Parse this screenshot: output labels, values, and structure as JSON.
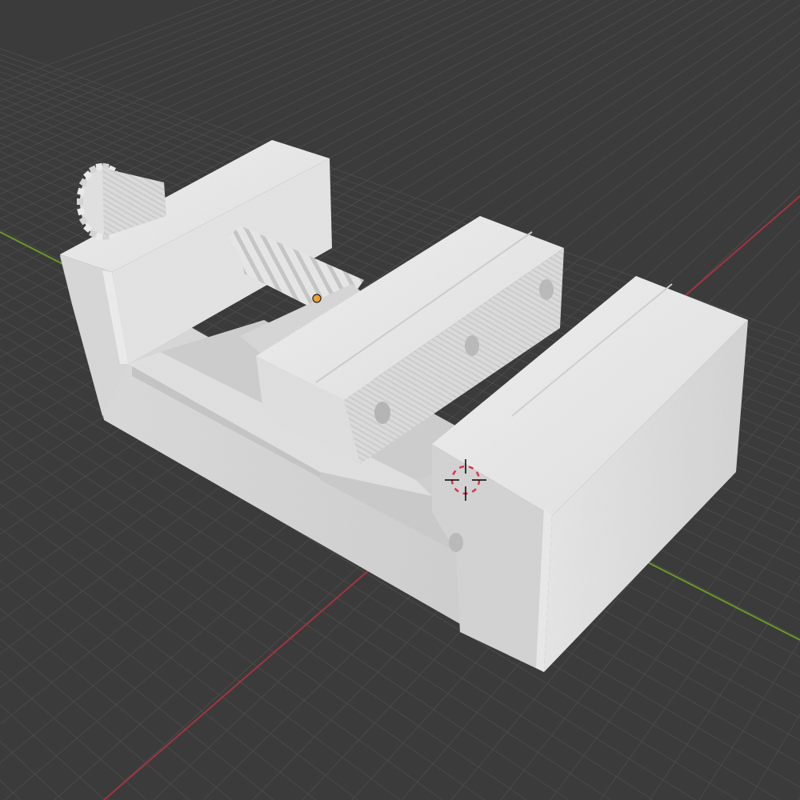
{
  "viewport": {
    "view_mode": "Solid"
  },
  "scene": {
    "objects": [
      {
        "name": "vise-body",
        "selected": false
      },
      {
        "name": "lead-screw",
        "selected": false
      },
      {
        "name": "drive-gear",
        "selected": false
      },
      {
        "name": "moving-jaw",
        "selected": false
      },
      {
        "name": "fixed-jaw",
        "selected": false
      }
    ],
    "origin_marker": {
      "selected_origin": true
    },
    "cursor_3d": {
      "visible": true
    }
  },
  "colors": {
    "background": "#3b3b3b",
    "grid_line": "#4a4a4a",
    "x_axis": "#a3343f",
    "y_axis": "#6a9a24",
    "model_light": "#eeeeee",
    "model_mid": "#d8d8d8",
    "model_dark": "#b4b4b4",
    "origin_dot": "#f0a030",
    "cursor_red": "#e0304a"
  },
  "icons": {
    "cursor": "3d-cursor-icon",
    "origin": "object-origin-icon"
  }
}
